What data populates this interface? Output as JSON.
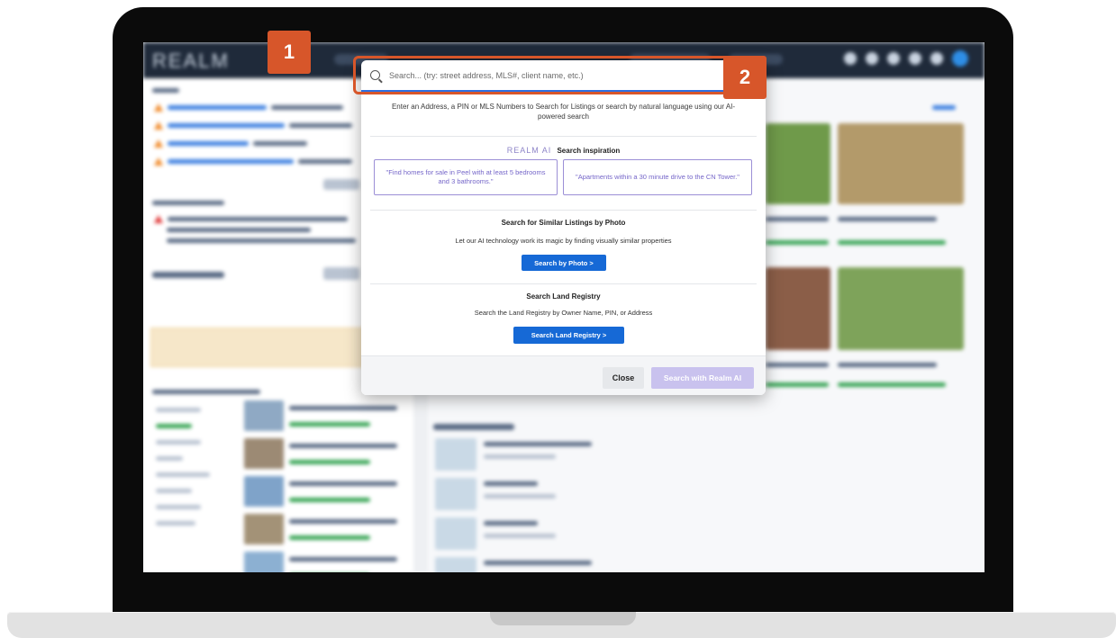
{
  "app": {
    "logo": "REALM"
  },
  "search": {
    "placeholder": "Search... (try: street address, MLS#, client name, etc.)",
    "intro": "Enter an Address, a PIN or MLS Numbers to Search for Listings or search by natural language using our AI-powered search"
  },
  "inspiration": {
    "logo": "REALM AI",
    "title": "Search inspiration",
    "suggestions": [
      "\"Find homes for sale in Peel with at least 5 bedrooms and 3 bathrooms.\"",
      "\"Apartments within a 30 minute drive to the CN Tower.\""
    ]
  },
  "photo_search": {
    "title": "Search for Similar Listings by Photo",
    "description": "Let our AI technology work its magic by finding visually similar properties",
    "button": "Search by Photo  >"
  },
  "land_registry": {
    "title": "Search Land Registry",
    "description": "Search the Land Registry by Owner Name, PIN, or Address",
    "button": "Search Land Registry  >"
  },
  "footer": {
    "close": "Close",
    "ai_search": "Search with Realm AI"
  },
  "callouts": {
    "one": "1",
    "two": "2"
  },
  "colors": {
    "accent": "#1669d6",
    "callout": "#d7562a",
    "ai_purple": "#7566c9"
  }
}
